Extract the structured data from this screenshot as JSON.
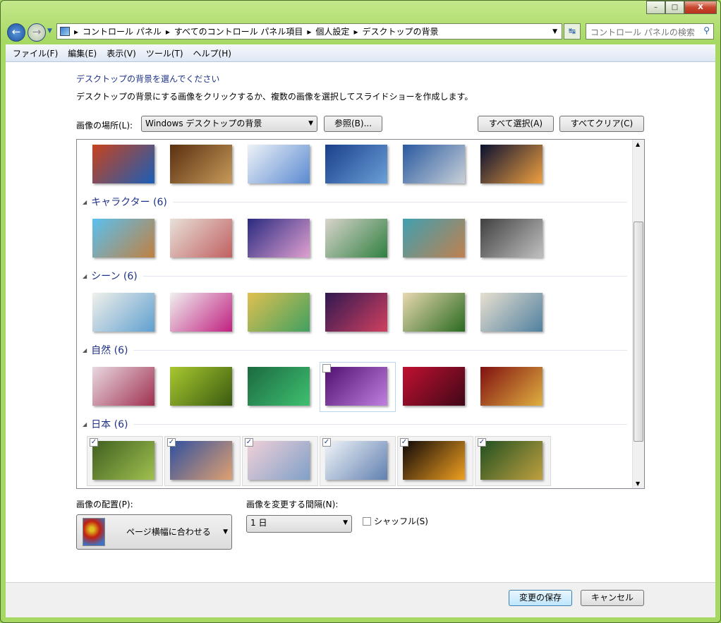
{
  "window": {
    "minimize": "–",
    "maximize": "□",
    "close": "X"
  },
  "address": {
    "segments": [
      "コントロール パネル",
      "すべてのコントロール パネル項目",
      "個人設定",
      "デスクトップの背景"
    ],
    "search_placeholder": "コントロール パネルの検索"
  },
  "menu": [
    "ファイル(F)",
    "編集(E)",
    "表示(V)",
    "ツール(T)",
    "ヘルプ(H)"
  ],
  "heading": "デスクトップの背景を選んでください",
  "description": "デスクトップの背景にする画像をクリックするか、複数の画像を選択してスライドショーを作成します。",
  "location_label": "画像の場所(L):",
  "location_value": "Windows デスクトップの背景",
  "browse_button": "参照(B)...",
  "select_all_button": "すべて選択(A)",
  "clear_all_button": "すべてクリア(C)",
  "groups": [
    {
      "title": "",
      "thumbs": [
        [
          "#c8421c",
          "#1a5fb8"
        ],
        [
          "#5a3010",
          "#c79a5a"
        ],
        [
          "#eef2f8",
          "#5a8ad0"
        ],
        [
          "#1a3f8a",
          "#6aa0d8"
        ],
        [
          "#2a5aa0",
          "#c8d0d8"
        ],
        [
          "#0a1030",
          "#f0a040"
        ]
      ]
    },
    {
      "title": "キャラクター (6)",
      "thumbs": [
        [
          "#5ac0f0",
          "#c08040"
        ],
        [
          "#e8e0d8",
          "#c06060"
        ],
        [
          "#2a2a80",
          "#e0a0d0"
        ],
        [
          "#d8d4cc",
          "#308040"
        ],
        [
          "#40a0b0",
          "#c08050"
        ],
        [
          "#404040",
          "#c0c0c0"
        ]
      ]
    },
    {
      "title": "シーン (6)",
      "thumbs": [
        [
          "#f0f0ea",
          "#60a0d0"
        ],
        [
          "#f0f0f0",
          "#c02080"
        ],
        [
          "#e0c050",
          "#40a060"
        ],
        [
          "#301850",
          "#d04060"
        ],
        [
          "#e8d8b0",
          "#2a6a20"
        ],
        [
          "#e8e0d0",
          "#5080a0"
        ]
      ]
    },
    {
      "title": "自然 (6)",
      "thumbs": [
        [
          "#e8d8e0",
          "#a03050"
        ],
        [
          "#a8c830",
          "#3a5a10"
        ],
        [
          "#1a6a40",
          "#40c070"
        ],
        [
          "#501070",
          "#c080e0"
        ],
        [
          "#c01030",
          "#400818"
        ],
        [
          "#801010",
          "#e0b040"
        ]
      ]
    },
    {
      "title": "日本 (6)",
      "thumbs": [
        [
          "#406020",
          "#a0c050"
        ],
        [
          "#3050a0",
          "#e0a070"
        ],
        [
          "#f0d0d8",
          "#80a0c8"
        ],
        [
          "#f0f4f8",
          "#6080b0"
        ],
        [
          "#100808",
          "#f0a020"
        ],
        [
          "#205020",
          "#c0a040"
        ]
      ]
    }
  ],
  "position_label": "画像の配置(P):",
  "position_value": "ページ横幅に合わせる",
  "interval_label": "画像を変更する間隔(N):",
  "interval_value": "1 日",
  "shuffle_label": "シャッフル(S)",
  "save_button": "変更の保存",
  "cancel_button": "キャンセル"
}
